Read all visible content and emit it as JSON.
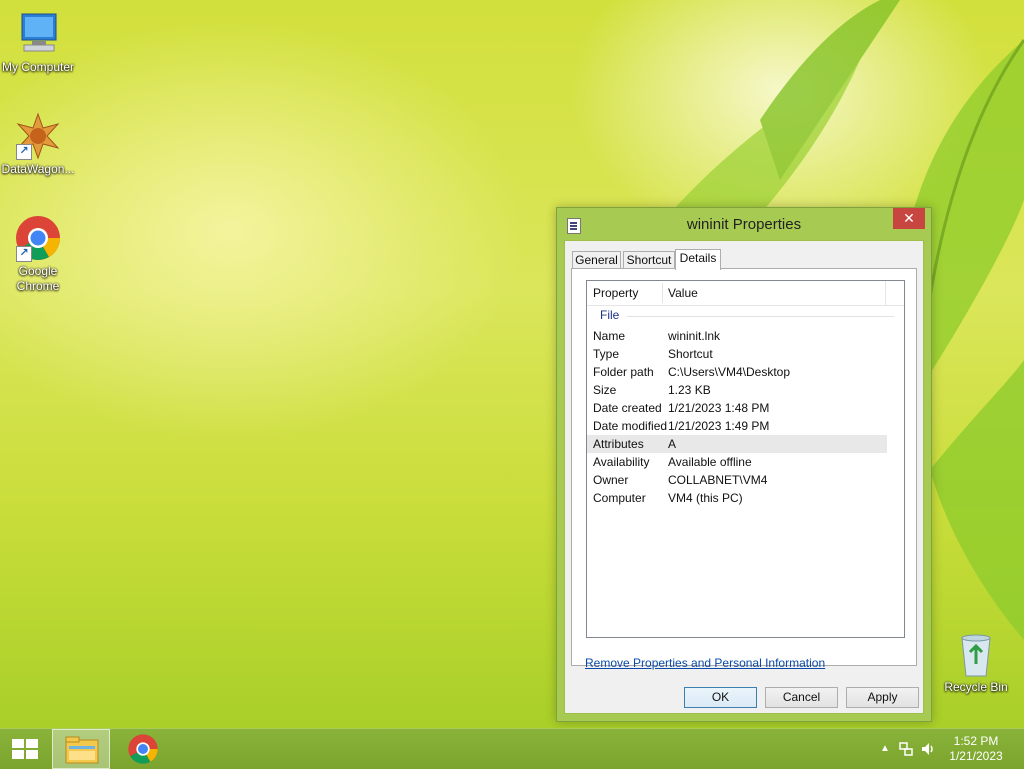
{
  "desktop": {
    "icons": [
      {
        "label": "My Computer"
      },
      {
        "label": "DataWagon..."
      },
      {
        "label": "Google Chrome"
      },
      {
        "label": "Recycle Bin"
      }
    ]
  },
  "dialog": {
    "title": "wininit Properties",
    "close_symbol": "✕",
    "tabs": [
      {
        "label": "General"
      },
      {
        "label": "Shortcut"
      },
      {
        "label": "Details",
        "active": true
      }
    ],
    "columns": {
      "property": "Property",
      "value": "Value"
    },
    "group": "File",
    "rows": [
      {
        "property": "Name",
        "value": "wininit.lnk"
      },
      {
        "property": "Type",
        "value": "Shortcut"
      },
      {
        "property": "Folder path",
        "value": "C:\\Users\\VM4\\Desktop"
      },
      {
        "property": "Size",
        "value": "1.23 KB"
      },
      {
        "property": "Date created",
        "value": "1/21/2023 1:48 PM"
      },
      {
        "property": "Date modified",
        "value": "1/21/2023 1:49 PM"
      },
      {
        "property": "Attributes",
        "value": "A",
        "selected": true
      },
      {
        "property": "Availability",
        "value": "Available offline"
      },
      {
        "property": "Owner",
        "value": "COLLABNET\\VM4"
      },
      {
        "property": "Computer",
        "value": "VM4 (this PC)"
      }
    ],
    "link": "Remove Properties and Personal Information",
    "buttons": {
      "ok": "OK",
      "cancel": "Cancel",
      "apply": "Apply"
    }
  },
  "taskbar": {
    "time": "1:52 PM",
    "date": "1/21/2023",
    "tray_icons": [
      "show-hidden-icons-chevron",
      "network-icon",
      "volume-icon"
    ]
  },
  "colors": {
    "taskbar": "#7aa42d",
    "dialog_frame": "#a7cb52",
    "close_button": "#c7463f",
    "link": "#0b4aa8"
  }
}
